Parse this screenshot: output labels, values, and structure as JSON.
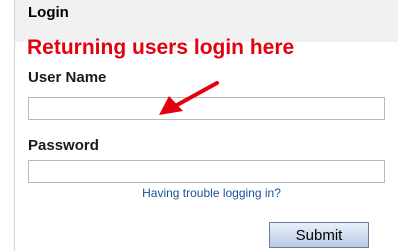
{
  "login": {
    "title": "Login",
    "annotation": "Returning users login here",
    "username_label": "User Name",
    "username_value": "",
    "password_label": "Password",
    "password_value": "",
    "trouble_link": "Having trouble logging in?",
    "submit_label": "Submit"
  },
  "colors": {
    "annotation": "#e3000f",
    "link": "#1b4f9c",
    "header_band": "#f1f1f1"
  },
  "icons": {
    "annotation_arrow": "red-arrow-icon"
  }
}
